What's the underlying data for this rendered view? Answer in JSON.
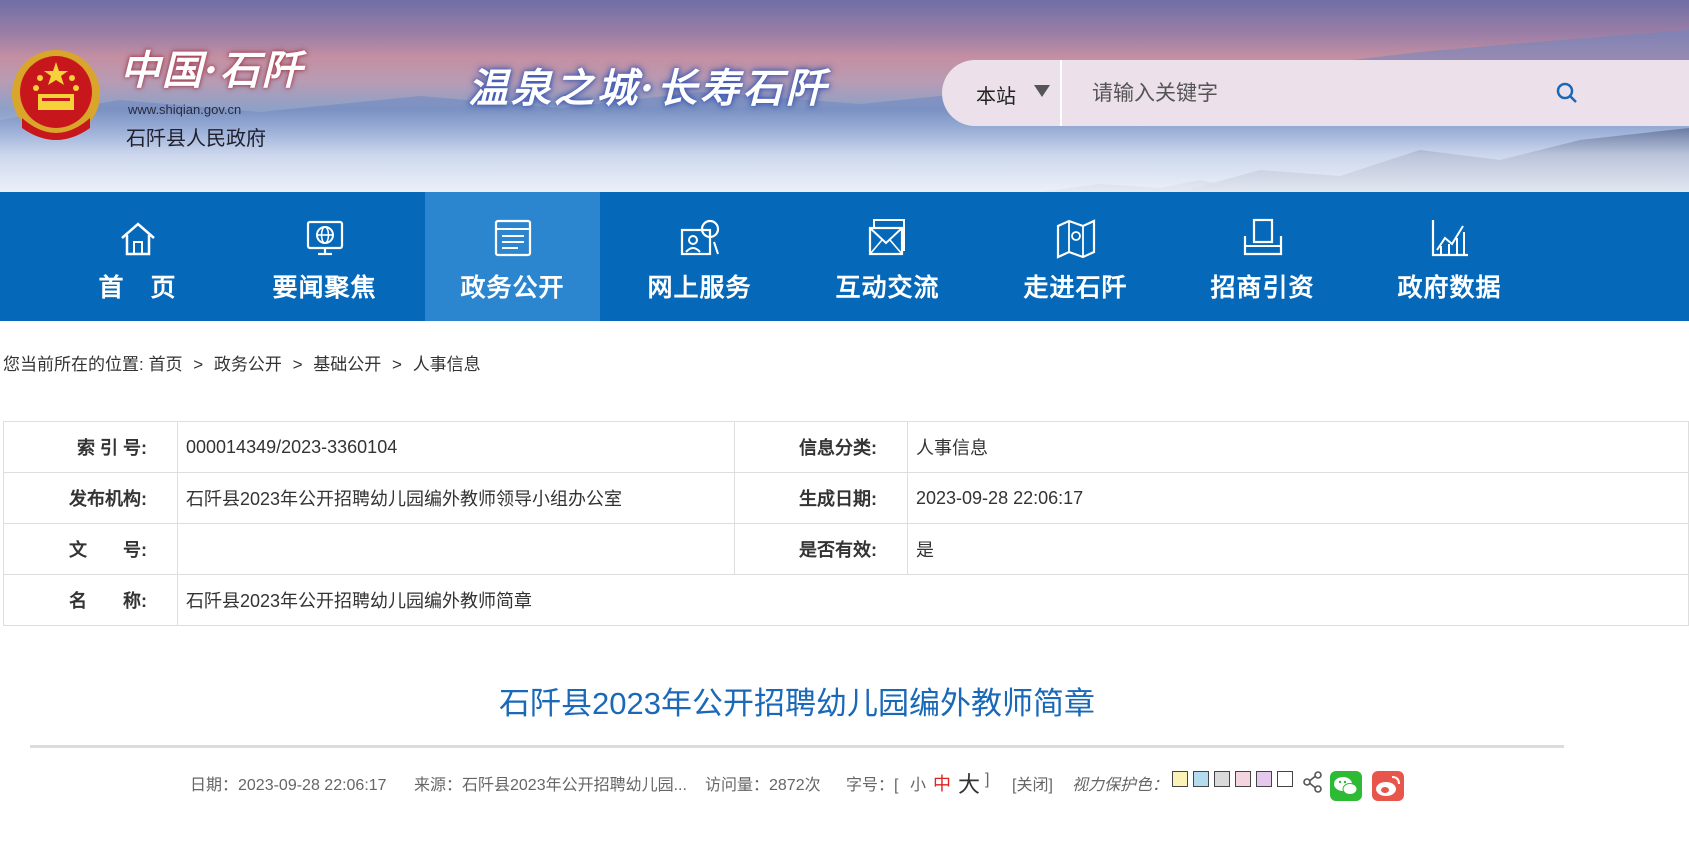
{
  "header": {
    "site_name": "中国·石阡",
    "site_url": "www.shiqian.gov.cn",
    "site_org": "石阡县人民政府",
    "slogan": "温泉之城·长寿石阡",
    "search": {
      "scope_label": "本站",
      "placeholder": "请输入关键字"
    },
    "banner_colors": {
      "nav_bg": "#0668b8",
      "nav_active_bg": "#2c86cf",
      "title_color": "#1a68b8"
    }
  },
  "nav": {
    "items": [
      {
        "label": "首　页",
        "icon": "home-icon"
      },
      {
        "label": "要闻聚焦",
        "icon": "globe-monitor-icon"
      },
      {
        "label": "政务公开",
        "icon": "document-list-icon",
        "active": true
      },
      {
        "label": "网上服务",
        "icon": "online-service-icon"
      },
      {
        "label": "互动交流",
        "icon": "mail-icon"
      },
      {
        "label": "走进石阡",
        "icon": "map-icon"
      },
      {
        "label": "招商引资",
        "icon": "box-icon"
      },
      {
        "label": "政府数据",
        "icon": "chart-icon"
      }
    ]
  },
  "breadcrumb": {
    "prefix": "您当前所在的位置:",
    "items": [
      "首页",
      "政务公开",
      "基础公开",
      "人事信息"
    ],
    "separator": ">"
  },
  "info": {
    "rows": [
      {
        "label1": "索 引 号:",
        "value1": "000014349/2023-3360104",
        "label2": "信息分类:",
        "value2": "人事信息"
      },
      {
        "label1": "发布机构:",
        "value1": "石阡县2023年公开招聘幼儿园编外教师领导小组办公室",
        "label2": "生成日期:",
        "value2": "2023-09-28 22:06:17"
      },
      {
        "label1": "文　　号:",
        "value1": "",
        "label2": "是否有效:",
        "value2": "是"
      },
      {
        "label1": "名　　称:",
        "value1": "石阡县2023年公开招聘幼儿园编外教师简章"
      }
    ]
  },
  "article": {
    "title": "石阡县2023年公开招聘幼儿园编外教师简章"
  },
  "meta": {
    "date": "日期：2023-09-28 22:06:17",
    "source": "来源：石阡县2023年公开招聘幼儿园...",
    "views": "访问量：2872次",
    "font_size_label": "字号：[",
    "font_small": "小",
    "font_medium": "中",
    "font_large": "大",
    "font_close_bracket": "]",
    "close": "[关闭]",
    "vision_label": "视力保护色：",
    "swatches": [
      "#fbf3b5",
      "#b3dcef",
      "#dadada",
      "#f4d4de",
      "#e4c9ec",
      "#ffffff"
    ]
  }
}
